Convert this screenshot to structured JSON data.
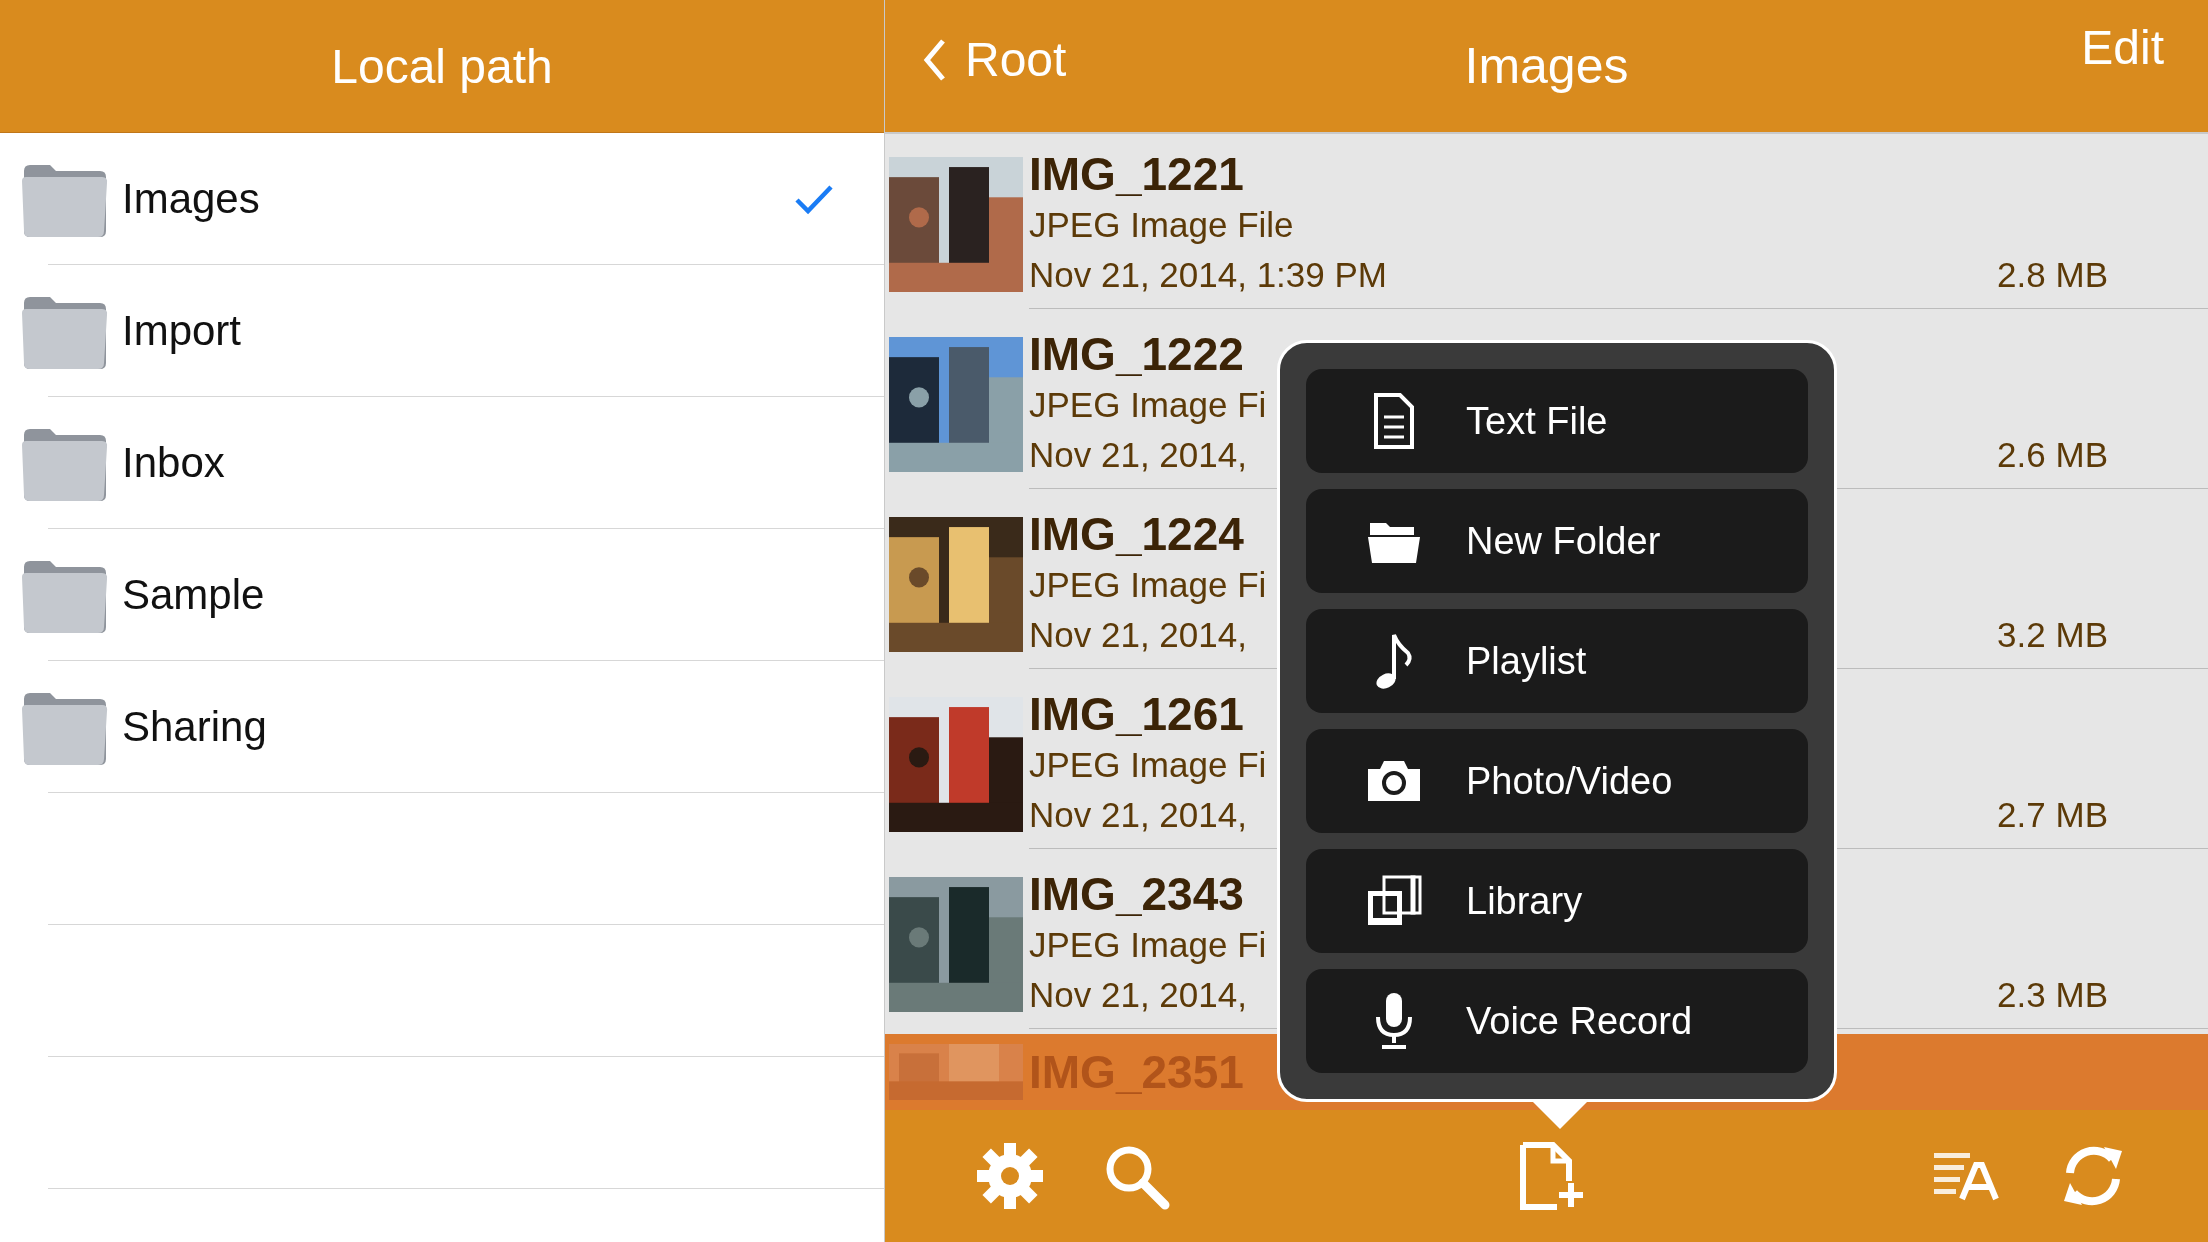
{
  "left_panel": {
    "title": "Local path",
    "folders": [
      {
        "name": "Images",
        "selected": true
      },
      {
        "name": "Import",
        "selected": false
      },
      {
        "name": "Inbox",
        "selected": false
      },
      {
        "name": "Sample",
        "selected": false
      },
      {
        "name": "Sharing",
        "selected": false
      }
    ]
  },
  "right_panel": {
    "back_label": "Root",
    "title": "Images",
    "edit_label": "Edit",
    "files": [
      {
        "name": "IMG_1221",
        "type": "JPEG Image File",
        "date": "Nov 21, 2014, 1:39 PM",
        "size": "2.8 MB"
      },
      {
        "name": "IMG_1222",
        "type": "JPEG Image Fi",
        "date": "Nov 21, 2014,",
        "size": "2.6 MB"
      },
      {
        "name": "IMG_1224",
        "type": "JPEG Image Fi",
        "date": "Nov 21, 2014,",
        "size": "3.2 MB"
      },
      {
        "name": "IMG_1261",
        "type": "JPEG Image Fi",
        "date": "Nov 21, 2014,",
        "size": "2.7 MB"
      },
      {
        "name": "IMG_2343",
        "type": "JPEG Image Fi",
        "date": "Nov 21, 2014,",
        "size": "2.3 MB"
      }
    ],
    "partial_file": {
      "name": "IMG_2351"
    },
    "create_menu": [
      {
        "kind": "text",
        "label": "Text File"
      },
      {
        "kind": "folder",
        "label": "New Folder"
      },
      {
        "kind": "music",
        "label": "Playlist"
      },
      {
        "kind": "camera",
        "label": "Photo/Video"
      },
      {
        "kind": "library",
        "label": "Library"
      },
      {
        "kind": "mic",
        "label": "Voice Record"
      }
    ]
  }
}
